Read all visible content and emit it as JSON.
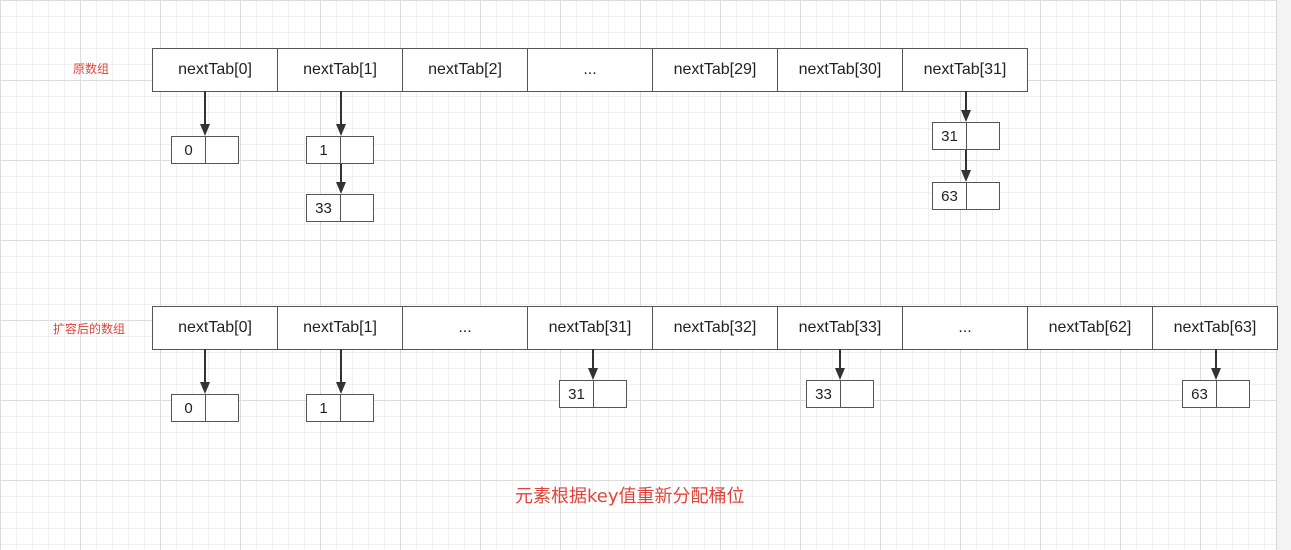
{
  "original_label": "原数组",
  "original_cells": [
    "nextTab[0]",
    "nextTab[1]",
    "nextTab[2]",
    "...",
    "nextTab[29]",
    "nextTab[30]",
    "nextTab[31]"
  ],
  "original_nodes": [
    "0",
    "1",
    "33",
    "31",
    "63"
  ],
  "expanded_label": "扩容后的数组",
  "expanded_cells": [
    "nextTab[0]",
    "nextTab[1]",
    "...",
    "nextTab[31]",
    "nextTab[32]",
    "nextTab[33]",
    "...",
    "nextTab[62]",
    "nextTab[63]"
  ],
  "expanded_nodes": [
    "0",
    "1",
    "31",
    "33",
    "63"
  ],
  "caption": "元素根据key值重新分配桶位",
  "colors": {
    "accent": "#e0453c",
    "line": "#333333"
  }
}
